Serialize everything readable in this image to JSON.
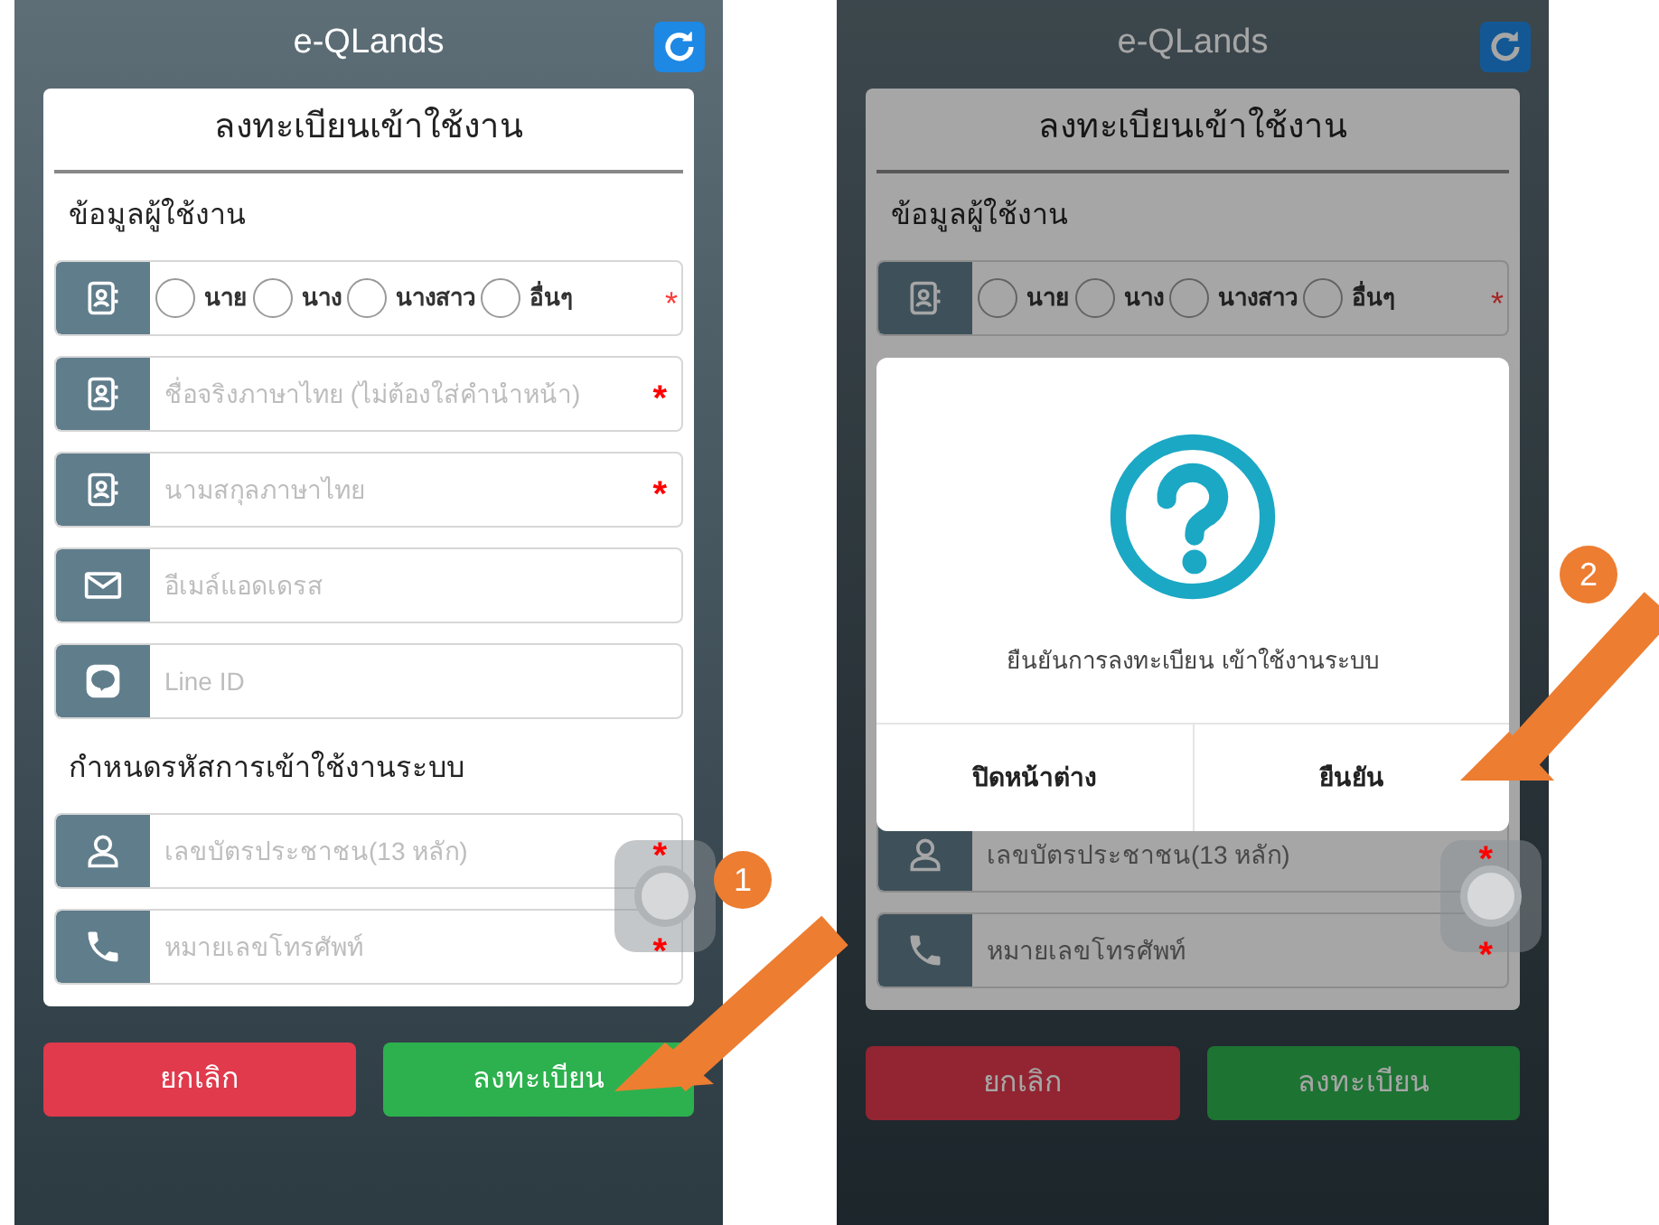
{
  "screens": [
    {
      "app_title": "e-QLands",
      "form": {
        "title": "ลงทะเบียนเข้าใช้งาน",
        "items": [
          {
            "kind": "heading",
            "text": "ข้อมูลผู้ใช้งาน"
          },
          {
            "kind": "radio",
            "required": "*",
            "options": [
              {
                "label": "นาย",
                "selected": false
              },
              {
                "label": "นาง",
                "selected": false
              },
              {
                "label": "นางสาว",
                "selected": false
              },
              {
                "label": "อื่นๆ",
                "selected": false
              }
            ]
          },
          {
            "kind": "contact",
            "placeholder": "ชื่อจริงภาษาไทย (ไม่ต้องใส่คำนำหน้า)",
            "required": "*"
          },
          {
            "kind": "contact",
            "placeholder": "นามสกุลภาษาไทย",
            "required": "*"
          },
          {
            "kind": "email",
            "placeholder": "อีเมล์แอดเดรส"
          },
          {
            "kind": "line",
            "placeholder": "Line ID"
          },
          {
            "kind": "heading",
            "text": "กำหนดรหัสการเข้าใช้งานระบบ"
          },
          {
            "kind": "person",
            "placeholder": "เลขบัตรประชาชน(13 หลัก)",
            "required": "*"
          },
          {
            "kind": "phone",
            "placeholder": "หมายเลขโทรศัพท์",
            "required": "*"
          }
        ]
      },
      "buttons": [
        {
          "kind": "cancel",
          "label": "ยกเลิก"
        },
        {
          "kind": "confirm",
          "label": "ลงทะเบียน"
        }
      ]
    },
    {
      "app_title": "e-QLands",
      "form": {
        "title": "ลงทะเบียนเข้าใช้งาน",
        "items": [
          {
            "kind": "heading",
            "text": "ข้อมูลผู้ใช้งาน"
          },
          {
            "kind": "radio",
            "required": "*",
            "options": [
              {
                "label": "นาย",
                "selected": false
              },
              {
                "label": "นาง",
                "selected": false
              },
              {
                "label": "นางสาว",
                "selected": false
              },
              {
                "label": "อื่นๆ",
                "selected": false
              }
            ]
          },
          {
            "kind": "dialog",
            "message": "ยืนยันการลงทะเบียน เข้าใช้งานระบบ",
            "buttons": [
              "ปิดหน้าต่าง",
              "ยืนยัน"
            ]
          },
          {
            "kind": "person",
            "placeholder": "เลขบัตรประชาชน(13 หลัก)",
            "required": "*"
          },
          {
            "kind": "phone",
            "placeholder": "หมายเลขโทรศัพท์",
            "required": "*"
          }
        ]
      },
      "buttons": [
        {
          "kind": "cancel",
          "label": "ยกเลิก"
        },
        {
          "kind": "confirm",
          "label": "ลงทะเบียน"
        }
      ]
    }
  ],
  "annotations": [
    {
      "number": "1"
    },
    {
      "number": "2"
    }
  ]
}
